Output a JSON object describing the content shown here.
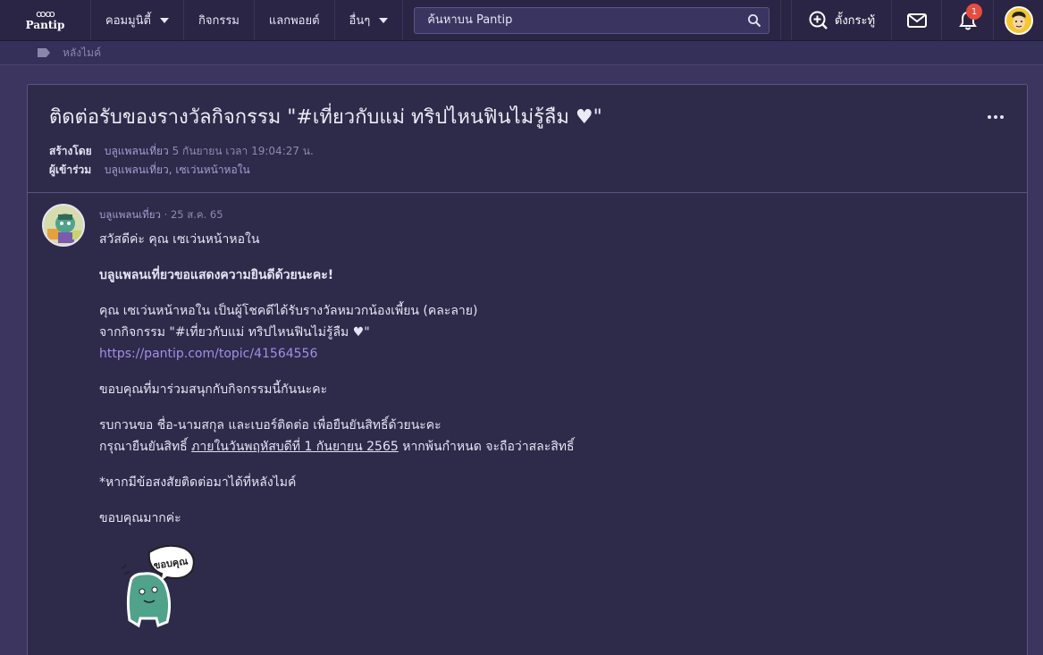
{
  "nav": {
    "logo": "Pantip",
    "logo_loops": "ꝏꝏ",
    "menu": [
      {
        "label": "คอมมูนิตี้",
        "dropdown": true
      },
      {
        "label": "กิจกรรม",
        "dropdown": false
      },
      {
        "label": "แลกพอยต์",
        "dropdown": false
      },
      {
        "label": "อื่นๆ",
        "dropdown": true
      }
    ],
    "search_placeholder": "ค้นหาบน Pantip",
    "new_topic": "ตั้งกระทู้",
    "notification_count": "1"
  },
  "breadcrumb": {
    "label": "หลังไมค์"
  },
  "topic": {
    "title": "ติดต่อรับของรางวัลกิจกรรม \"#เที่ยวกับแม่ ทริปไหนฟินไม่รู้ลืม ♥\"",
    "created_label": "สร้างโดย",
    "created_user": "บลูแพลนเที่ยว",
    "created_time": "5 กันยายน เวลา 19:04:27 น.",
    "participants_label": "ผู้เข้าร่วม",
    "participants": "บลูแพลนเที่ยว, เซเว่นหน้าหอใน"
  },
  "post": {
    "user": "บลูแพลนเที่ยว",
    "sep": " · ",
    "date": "25 ส.ค. 65",
    "greeting": "สวัสดีค่ะ คุณ เซเว่นหน้าหอใน",
    "congrats": "บลูแพลนเที่ยวขอแสดงความยินดีด้วยนะคะ!",
    "winner_line": "คุณ เซเว่นหน้าหอใน เป็นผู้โชคดีได้รับรางวัลหมวกน้องเพี้ยน (คละลาย)",
    "from_line": "จากกิจกรรม \"#เที่ยวกับแม่ ทริปไหนฟินไม่รู้ลืม ♥\"",
    "link": "https://pantip.com/topic/41564556",
    "thanks_join": "ขอบคุณที่มาร่วมสนุกกับกิจกรรมนี้กันนะคะ",
    "request_line": "รบกวนขอ ชื่อ-นามสกุล และเบอร์ติดต่อ เพื่อยืนยันสิทธิ์ด้วยนะคะ",
    "confirm_prefix": "กรุณายืนยันสิทธิ์ ",
    "confirm_deadline": "ภายในวันพฤหัสบดีที่ 1 กันยายน 2565",
    "confirm_suffix": " หากพ้นกำหนด จะถือว่าสละสิทธิ์",
    "question_line": "*หากมีข้อสงสัยติดต่อมาได้ที่หลังไมค์",
    "thanks_final": "ขอบคุณมากค่ะ",
    "sticker_text": "ขอบคุณ"
  },
  "colors": {
    "background": "#3b3560",
    "navbar": "#2a2544",
    "card": "#2d2a4a",
    "link": "#a48ee4",
    "badge": "#e74c3c"
  }
}
